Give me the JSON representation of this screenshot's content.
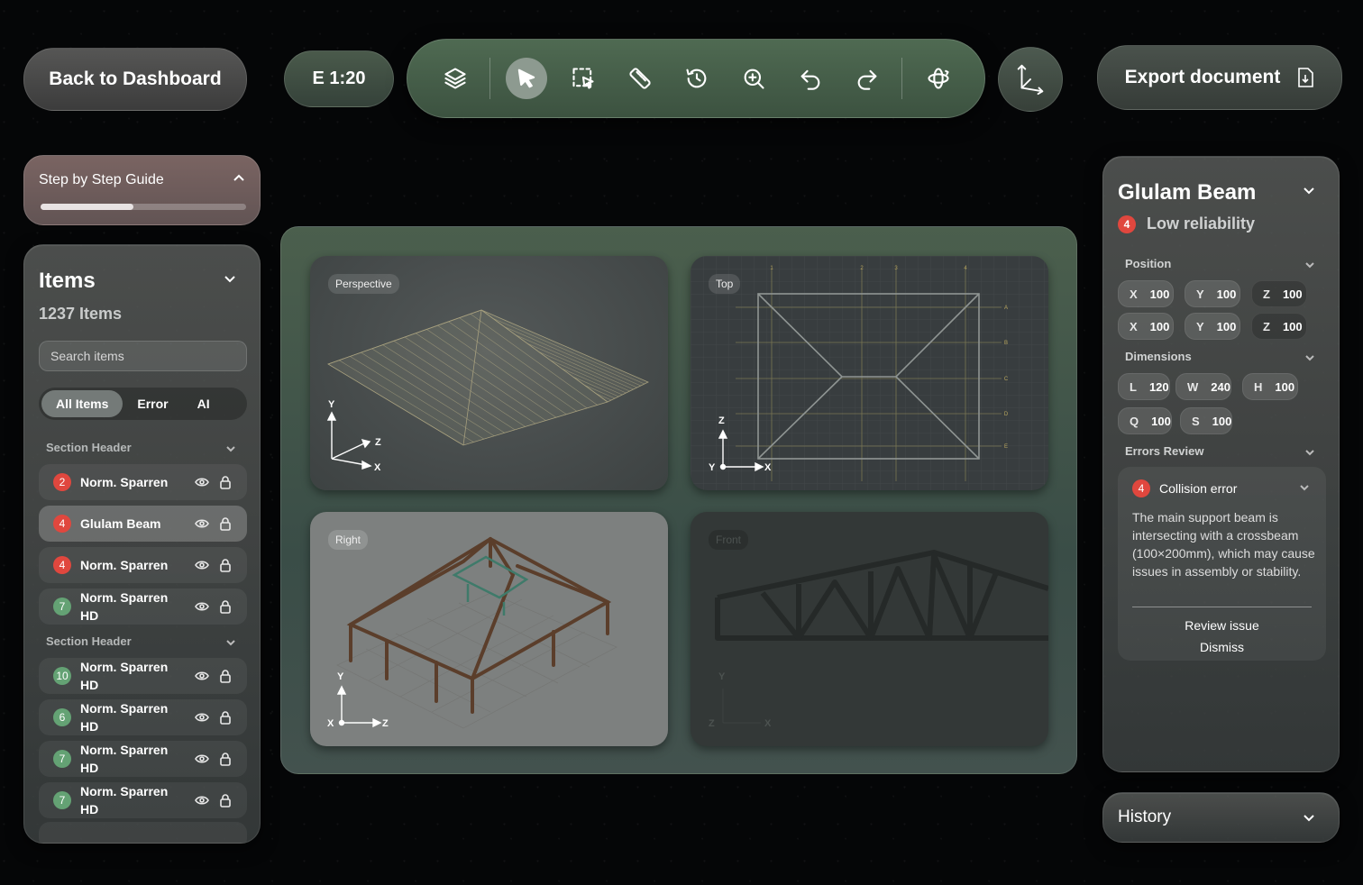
{
  "header": {
    "back_label": "Back to Dashboard",
    "scale_label": "E 1:20",
    "export_label": "Export document",
    "tools": [
      "layers-icon",
      "pointer-icon",
      "marquee-select-icon",
      "ruler-icon",
      "history-icon",
      "zoom-in-icon",
      "undo-icon",
      "redo-icon",
      "orbit-icon"
    ]
  },
  "guide": {
    "title": "Step by Step Guide",
    "progress": 0.45
  },
  "items": {
    "title": "Items",
    "count": "1237 Items",
    "search_placeholder": "Search items",
    "filters": [
      "All Items",
      "Error",
      "AI"
    ],
    "active_filter": "All Items",
    "section1": "Section Header",
    "section2": "Section Header",
    "rows": [
      {
        "badge": "2",
        "color": "red",
        "label": "Norm. Sparren"
      },
      {
        "badge": "4",
        "color": "red",
        "label": "Glulam Beam"
      },
      {
        "badge": "4",
        "color": "red",
        "label": "Norm. Sparren"
      },
      {
        "badge": "7",
        "color": "green",
        "label": "Norm. Sparren HD"
      },
      {
        "badge": "10",
        "color": "green",
        "label": "Norm. Sparren HD"
      },
      {
        "badge": "6",
        "color": "green",
        "label": "Norm. Sparren HD"
      },
      {
        "badge": "7",
        "color": "green",
        "label": "Norm. Sparren HD"
      },
      {
        "badge": "7",
        "color": "green",
        "label": "Norm. Sparren HD"
      }
    ]
  },
  "views": {
    "perspective": {
      "label": "Perspective",
      "axes": [
        "Y",
        "Z",
        "X"
      ]
    },
    "top": {
      "label": "Top",
      "axes": [
        "Z",
        "Y",
        "X"
      ],
      "grid_cols": [
        "1",
        "2",
        "3",
        "4"
      ],
      "grid_rows": [
        "A",
        "B",
        "C",
        "D",
        "E"
      ]
    },
    "right": {
      "label": "Right",
      "axes": [
        "Y",
        "X",
        "Z"
      ]
    },
    "front": {
      "label": "Front",
      "axes": [
        "Y",
        "Z",
        "X"
      ]
    }
  },
  "props": {
    "title": "Glulam Beam",
    "badge": "4",
    "reliability": "Low reliability",
    "position_label": "Position",
    "position": [
      {
        "k": "X",
        "v": "100"
      },
      {
        "k": "Y",
        "v": "100"
      },
      {
        "k": "Z",
        "v": "100"
      },
      {
        "k": "X",
        "v": "100"
      },
      {
        "k": "Y",
        "v": "100"
      },
      {
        "k": "Z",
        "v": "100"
      }
    ],
    "dimensions_label": "Dimensions",
    "dimensions": [
      {
        "k": "L",
        "v": "120"
      },
      {
        "k": "W",
        "v": "240"
      },
      {
        "k": "H",
        "v": "100"
      },
      {
        "k": "Q",
        "v": "100"
      },
      {
        "k": "S",
        "v": "100"
      }
    ],
    "errors_label": "Errors Review",
    "error": {
      "badge": "4",
      "title": "Collision error",
      "description": "The main support beam is intersecting with a crossbeam (100×200mm), which may cause issues in assembly or stability.",
      "action1": "Review issue",
      "action2": "Dismiss"
    }
  },
  "history": {
    "title": "History"
  },
  "colors": {
    "error": "#e0473e",
    "ok": "#64a274",
    "toolbar": "#4f6a52"
  }
}
